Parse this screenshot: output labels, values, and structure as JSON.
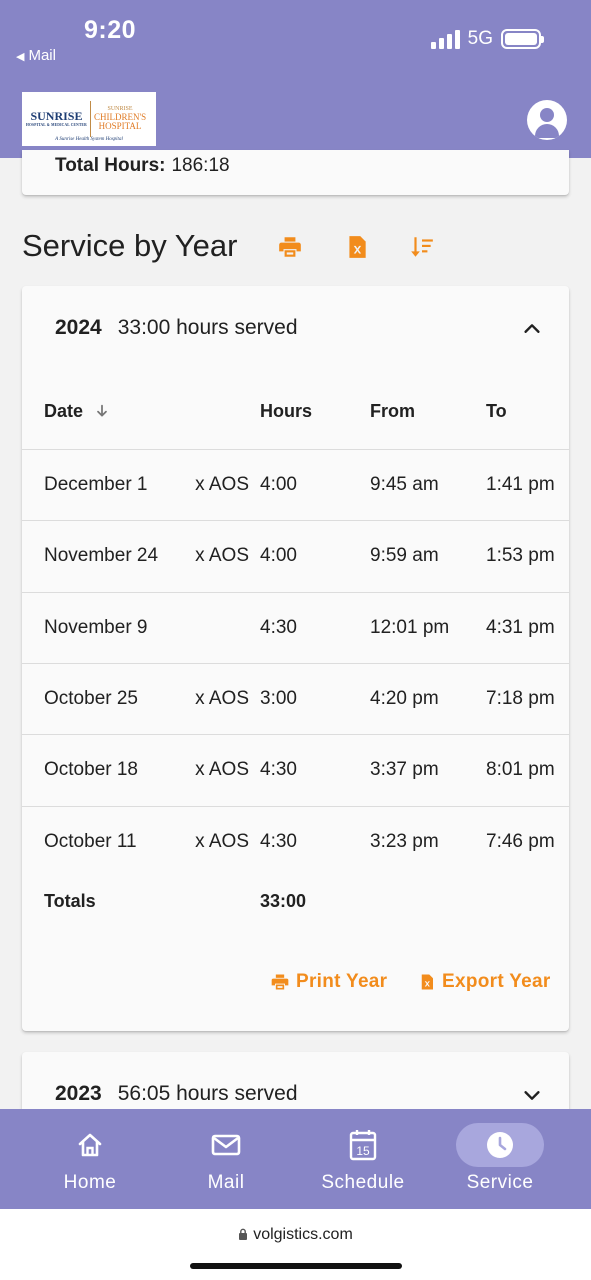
{
  "status_bar": {
    "time": "9:20",
    "back_app": "Mail",
    "network": "5G"
  },
  "header": {
    "logo": {
      "brand_line1": "SUNRISE",
      "brand_line1_sub": "HOSPITAL & MEDICAL CENTER",
      "brand_line2a": "SUNRISE",
      "brand_line2b": "CHILDREN'S",
      "brand_line2c": "HOSPITAL",
      "tagline": "A Sunrise Health System Hospital"
    },
    "avatar_icon": "account-circle-icon"
  },
  "summary": {
    "label": "Total Hours:",
    "value": "186:18"
  },
  "section": {
    "title": "Service by Year",
    "icons": [
      "print-icon",
      "excel-file-icon",
      "sort-descending-icon"
    ]
  },
  "years": [
    {
      "year": "2024",
      "hours_served": "33:00 hours served",
      "expanded": true,
      "columns": [
        "Date",
        "Hours",
        "From",
        "To"
      ],
      "sort_icon": "arrow-down-icon",
      "rows": [
        {
          "date": "December 1",
          "location": "x AOS",
          "hours": "4:00",
          "from": "9:45 am",
          "to": "1:41 pm"
        },
        {
          "date": "November 24",
          "location": "x AOS",
          "hours": "4:00",
          "from": "9:59 am",
          "to": "1:53 pm"
        },
        {
          "date": "November 9",
          "location": "",
          "hours": "4:30",
          "from": "12:01 pm",
          "to": "4:31 pm"
        },
        {
          "date": "October 25",
          "location": "x AOS",
          "hours": "3:00",
          "from": "4:20 pm",
          "to": "7:18 pm"
        },
        {
          "date": "October 18",
          "location": "x AOS",
          "hours": "4:30",
          "from": "3:37 pm",
          "to": "8:01 pm"
        },
        {
          "date": "October 11",
          "location": "x AOS",
          "hours": "4:30",
          "from": "3:23 pm",
          "to": "7:46 pm"
        }
      ],
      "totals_label": "Totals",
      "totals_value": "33:00",
      "print_label": "Print Year",
      "export_label": "Export Year"
    },
    {
      "year": "2023",
      "hours_served": "56:05 hours served",
      "expanded": false
    }
  ],
  "bottom_nav": [
    {
      "label": "Home",
      "icon": "home-icon",
      "active": false
    },
    {
      "label": "Mail",
      "icon": "mail-icon",
      "active": false
    },
    {
      "label": "Schedule",
      "icon": "calendar-icon",
      "calendar_day": "15",
      "active": false
    },
    {
      "label": "Service",
      "icon": "clock-icon",
      "active": true
    }
  ],
  "browser": {
    "url": "volgistics.com"
  },
  "colors": {
    "brand_purple": "#8785c6",
    "accent_orange": "#f28c1c",
    "card_bg": "#fafafa"
  }
}
